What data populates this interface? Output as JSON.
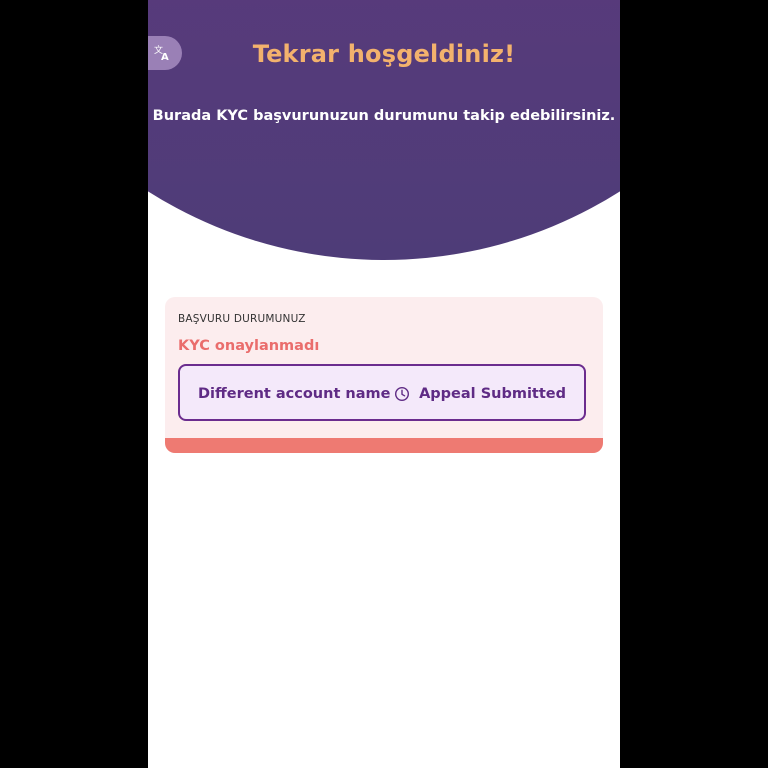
{
  "header": {
    "title": "Tekrar hoşgeldiniz!",
    "subtitle": "Burada KYC başvurunuzun durumunu takip edebilirsiniz.",
    "language_icon": "translate-icon"
  },
  "status_card": {
    "label": "BAŞVURU DURUMUNUZ",
    "value": "KYC onaylanmadı",
    "reason": "Different account name",
    "appeal_icon": "clock-icon",
    "appeal_status": "Appeal Submitted"
  },
  "colors": {
    "header_bg": "#5a3a7c",
    "title": "#f3b26d",
    "status_value": "#ea6d6c",
    "card_bg": "#fcedee",
    "reason_border": "#6b2c8e",
    "status_bar": "#ee7a72"
  }
}
